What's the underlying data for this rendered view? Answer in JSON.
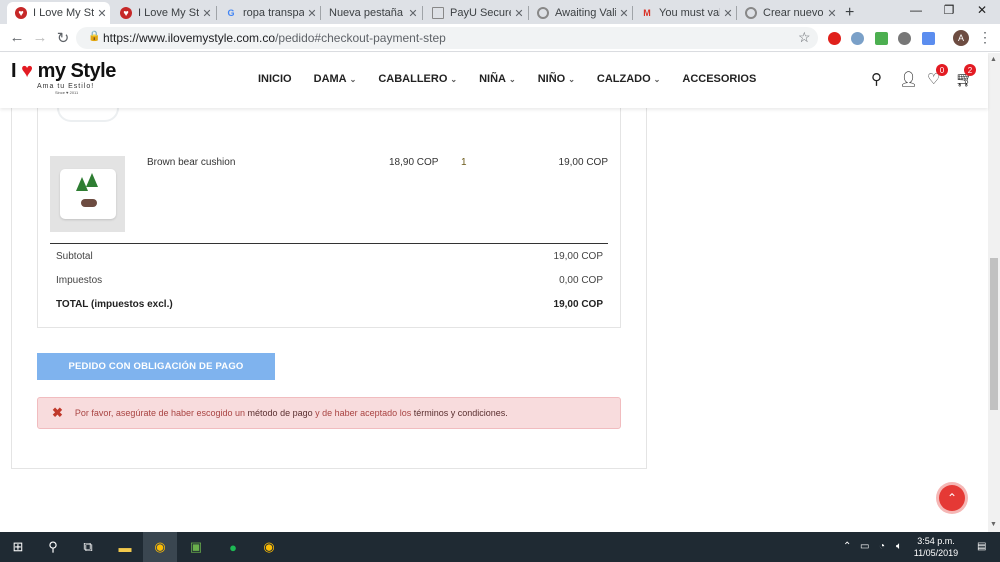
{
  "browser": {
    "tabs": [
      {
        "title": "I Love My Style",
        "active": true
      },
      {
        "title": "I Love My Style"
      },
      {
        "title": "ropa transparente"
      },
      {
        "title": "Nueva pestaña"
      },
      {
        "title": "PayU Secure - "
      },
      {
        "title": "Awaiting Validat"
      },
      {
        "title": "You must valida"
      },
      {
        "title": "Crear nuevo ti"
      }
    ],
    "url_host": "https://www.ilovemystyle.com.co",
    "url_path": "/pedido#checkout-payment-step",
    "profile_initial": "A"
  },
  "site": {
    "logo_text": "my Style",
    "logo_prefix": "I",
    "tagline": "Ama tu Estilo!",
    "since": "Since ♥ 2011",
    "menu": [
      {
        "label": "INICIO",
        "dropdown": false
      },
      {
        "label": "DAMA",
        "dropdown": true
      },
      {
        "label": "CABALLERO",
        "dropdown": true
      },
      {
        "label": "NIÑA",
        "dropdown": true
      },
      {
        "label": "NIÑO",
        "dropdown": true
      },
      {
        "label": "CALZADO",
        "dropdown": true
      },
      {
        "label": "ACCESORIOS",
        "dropdown": false
      }
    ],
    "wishlist_count": "0",
    "cart_count": "2"
  },
  "order": {
    "product": {
      "name": "Brown bear cushion",
      "unit_price": "18,90 COP",
      "quantity": "1",
      "total": "19,00 COP"
    },
    "summary": [
      {
        "label": "Subtotal",
        "value": "19,00 COP"
      },
      {
        "label": "Impuestos",
        "value": "0,00 COP"
      },
      {
        "label": "TOTAL (impuestos excl.)",
        "value": "19,00 COP"
      }
    ],
    "pay_button": "PEDIDO CON OBLIGACIÓN DE PAGO",
    "alert": {
      "prefix": "Por favor, asegúrate de haber escogido un",
      "link1": "método de pago",
      "middle": "y de haber aceptado los",
      "link2": "términos y condiciones."
    }
  },
  "taskbar": {
    "time": "3:54 p.m.",
    "date": "11/05/2019"
  }
}
